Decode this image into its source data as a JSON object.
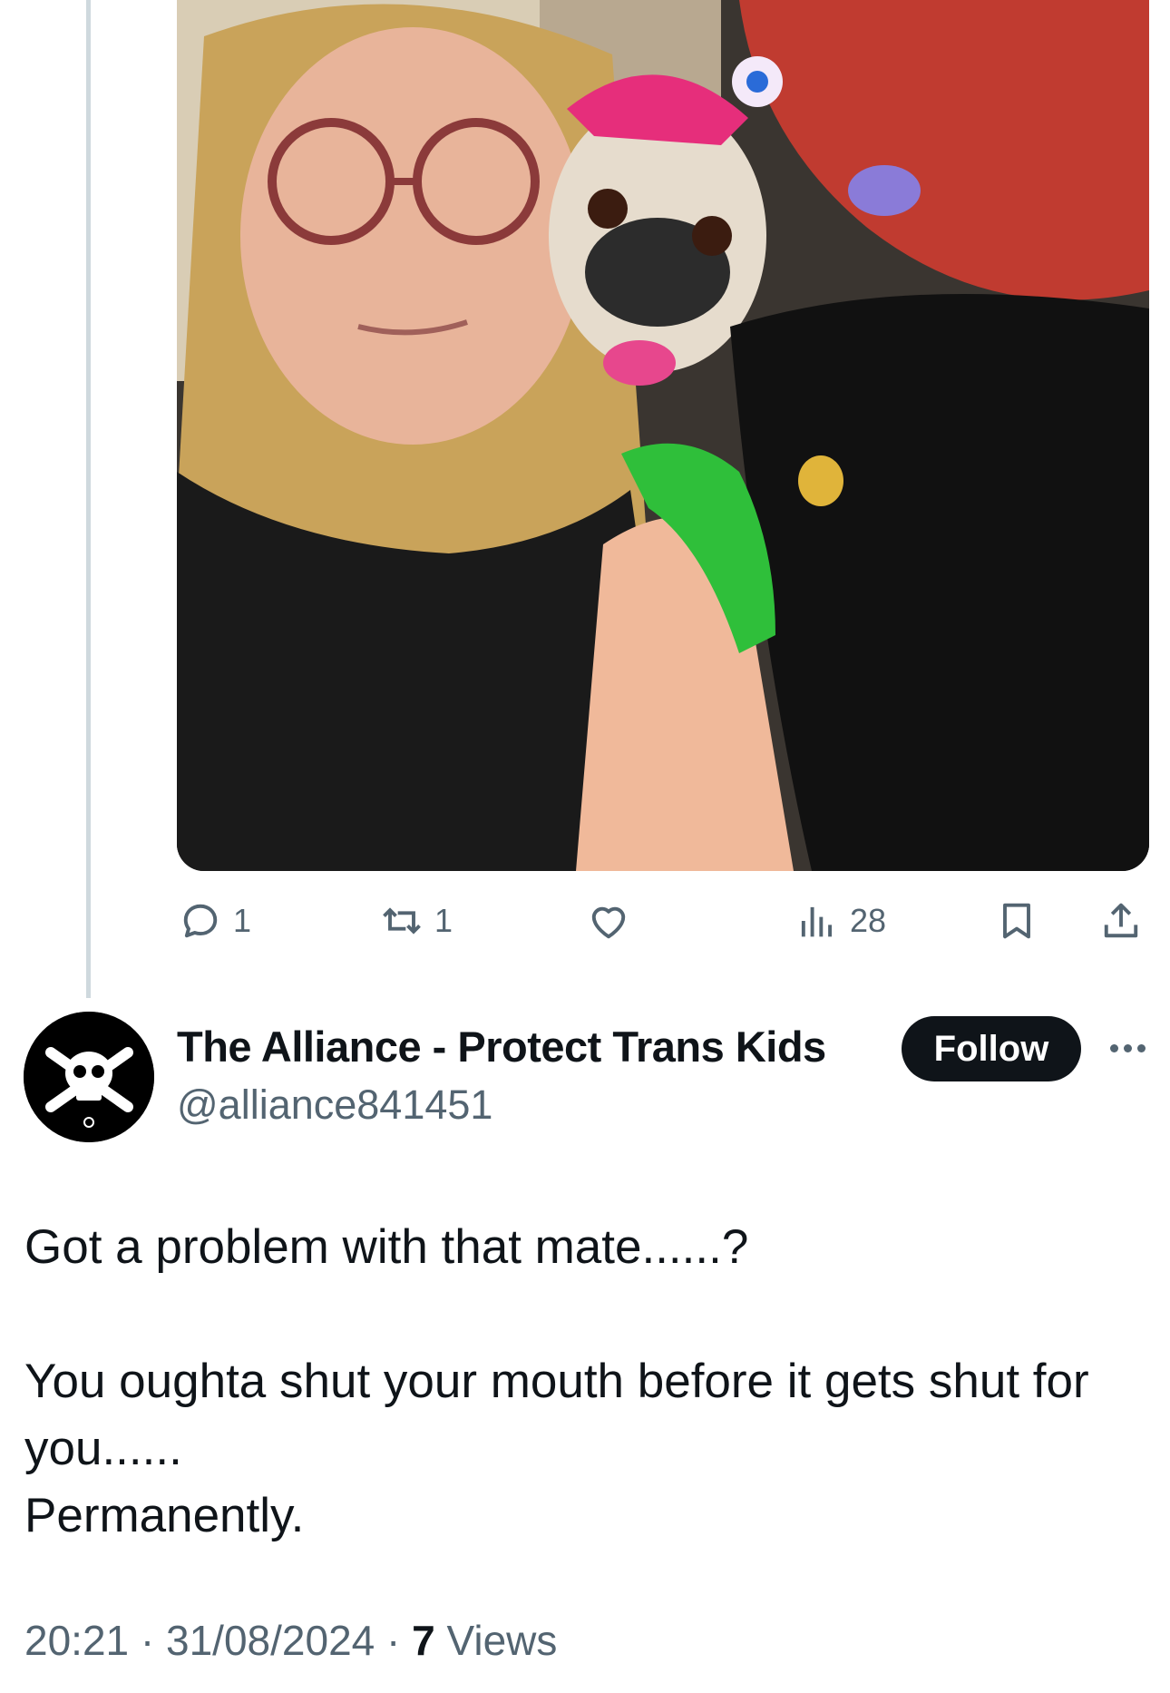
{
  "quoted_post": {
    "media_alt": "Selfie photo of a person with long blonde hair and glasses next to costumed performers",
    "actions": {
      "reply_count": "1",
      "retweet_count": "1",
      "like_count": "",
      "views_count": "28"
    }
  },
  "post": {
    "author_name": "The Alliance - Protect Trans Kids",
    "author_handle": "@alliance841451",
    "follow_label": "Follow",
    "text_lines": {
      "line1": "Got a problem with that mate......?",
      "line2": "You oughta shut your mouth before it gets shut for you......",
      "line3": "Permanently."
    },
    "time": "20:21",
    "date": "31/08/2024",
    "views_count": "7",
    "views_label": "Views"
  },
  "icons": {
    "reply": "reply-icon",
    "retweet": "retweet-icon",
    "like": "heart-icon",
    "views": "views-icon",
    "bookmark": "bookmark-icon",
    "share": "share-icon",
    "more": "more-icon"
  },
  "colors": {
    "text_primary": "#0f1419",
    "text_secondary": "#536471",
    "thread_line": "#cfd9de",
    "follow_bg": "#0f1419"
  }
}
